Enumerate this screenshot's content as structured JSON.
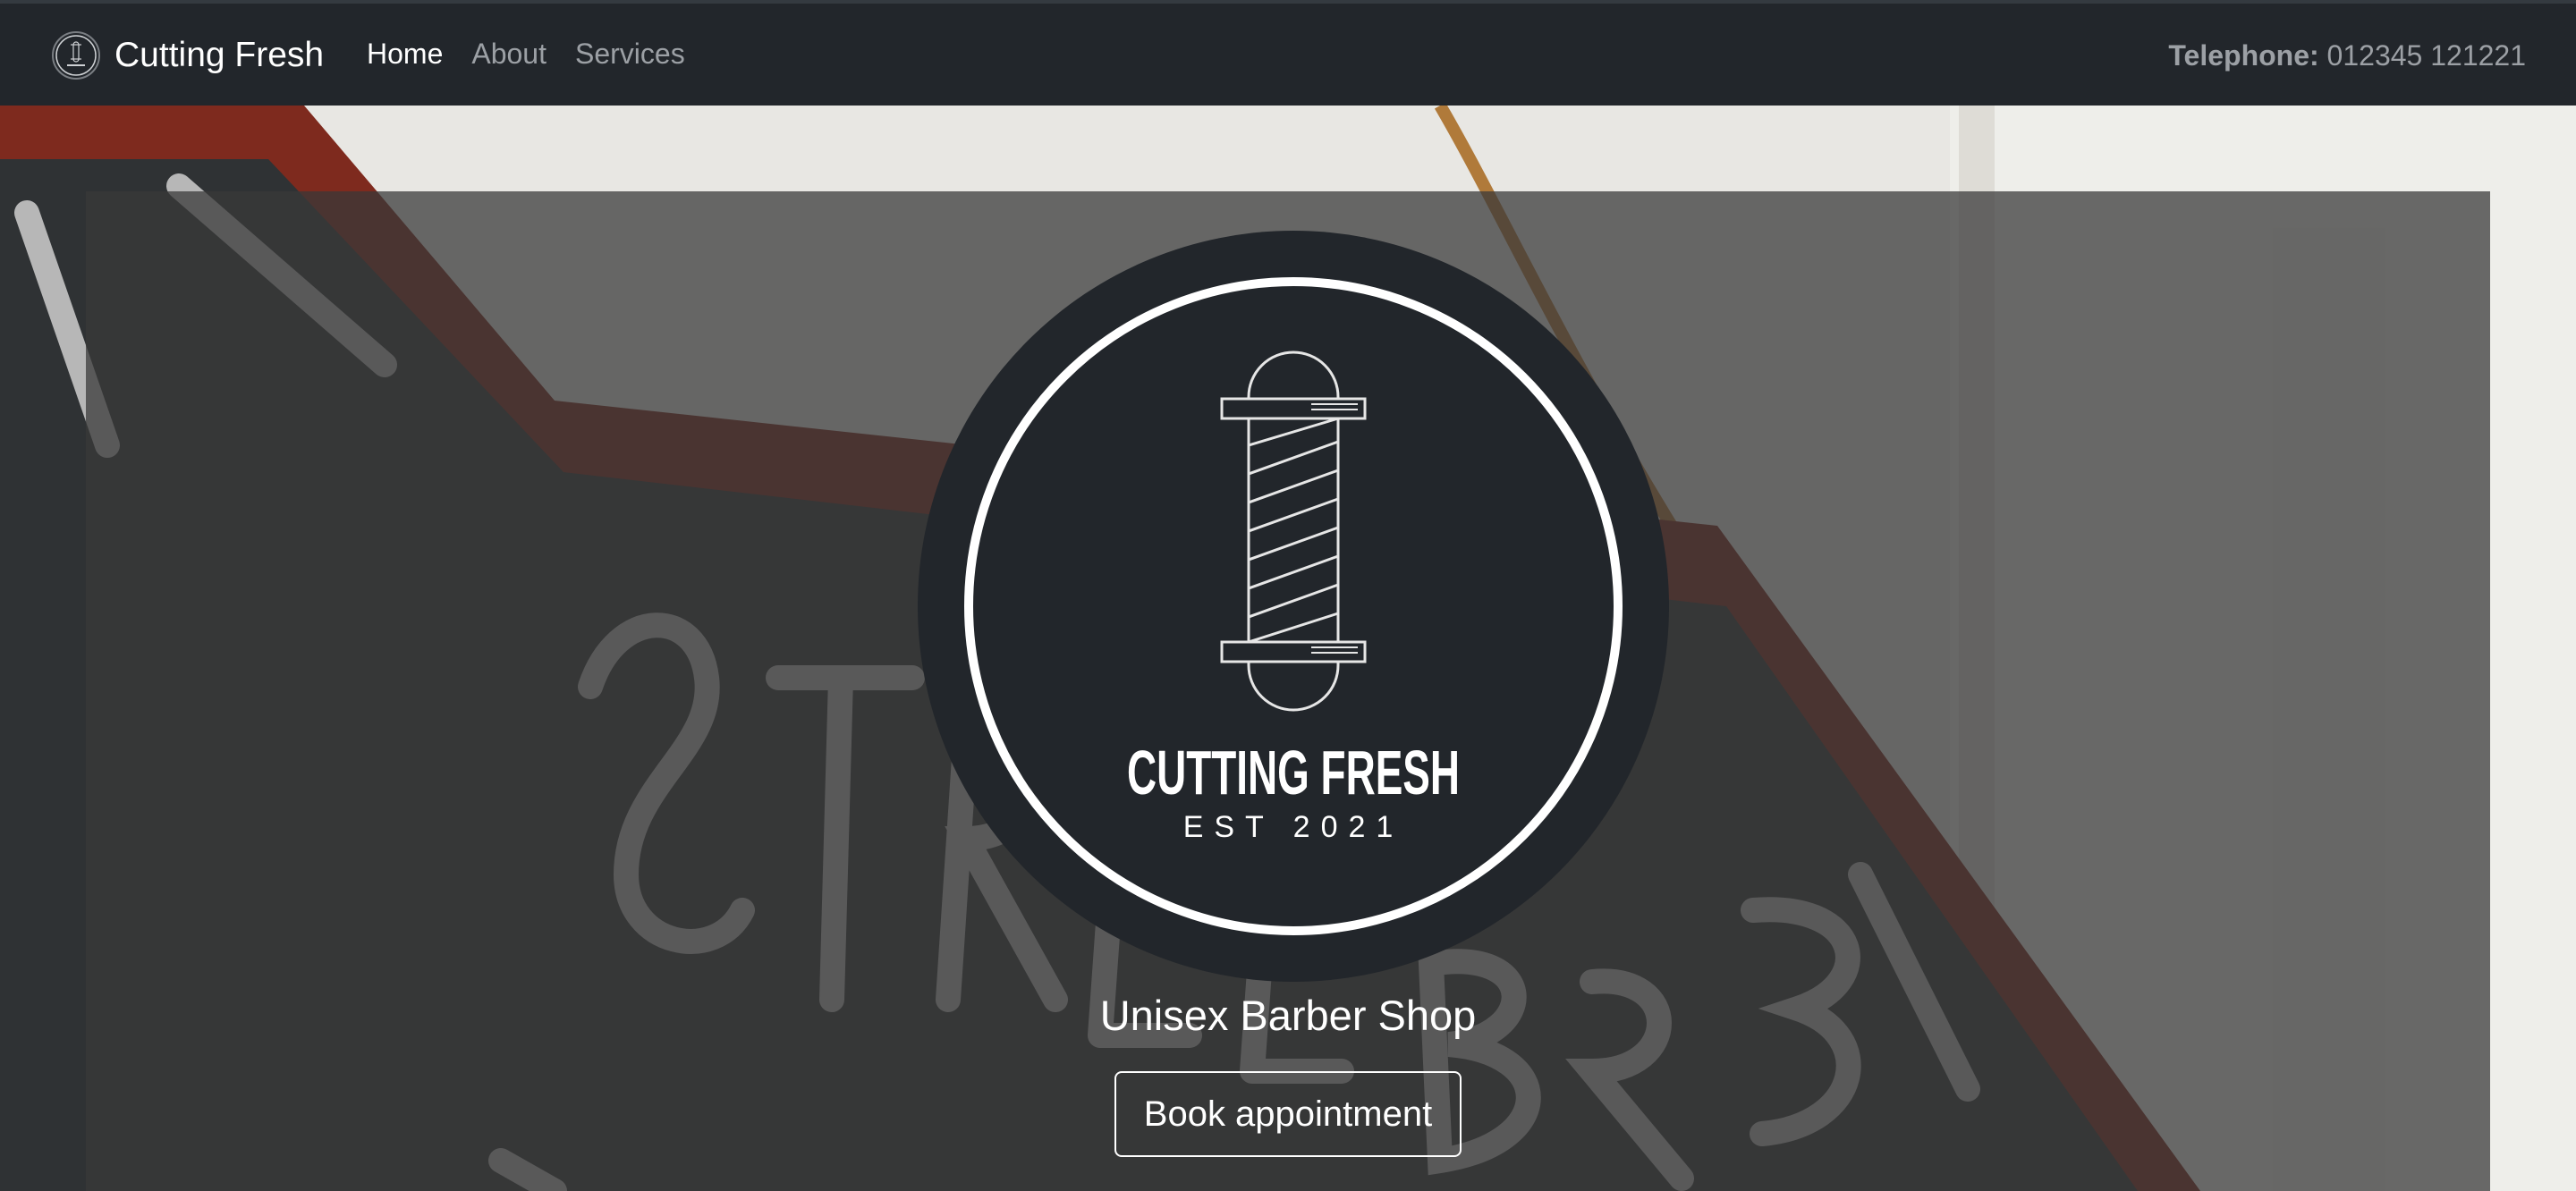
{
  "navbar": {
    "brand_logo_icon": "barber-pole-logo-icon",
    "brand_name": "Cutting Fresh",
    "links": [
      {
        "label": "Home",
        "active": true
      },
      {
        "label": "About",
        "active": false
      },
      {
        "label": "Services",
        "active": false
      }
    ],
    "phone_label": "Telephone:",
    "phone_number": "012345 121221"
  },
  "hero": {
    "logo": {
      "icon": "barber-pole-icon",
      "title": "CUTTING FRESH",
      "subtitle": "EST 2021"
    },
    "tagline": "Unisex Barber Shop",
    "book_button_label": "Book appointment"
  },
  "colors": {
    "navbar_bg": "#22262b",
    "overlay": "#383838",
    "logo_bg": "#22262b",
    "text": "#ffffff",
    "nav_muted": "#9ca0a5"
  }
}
